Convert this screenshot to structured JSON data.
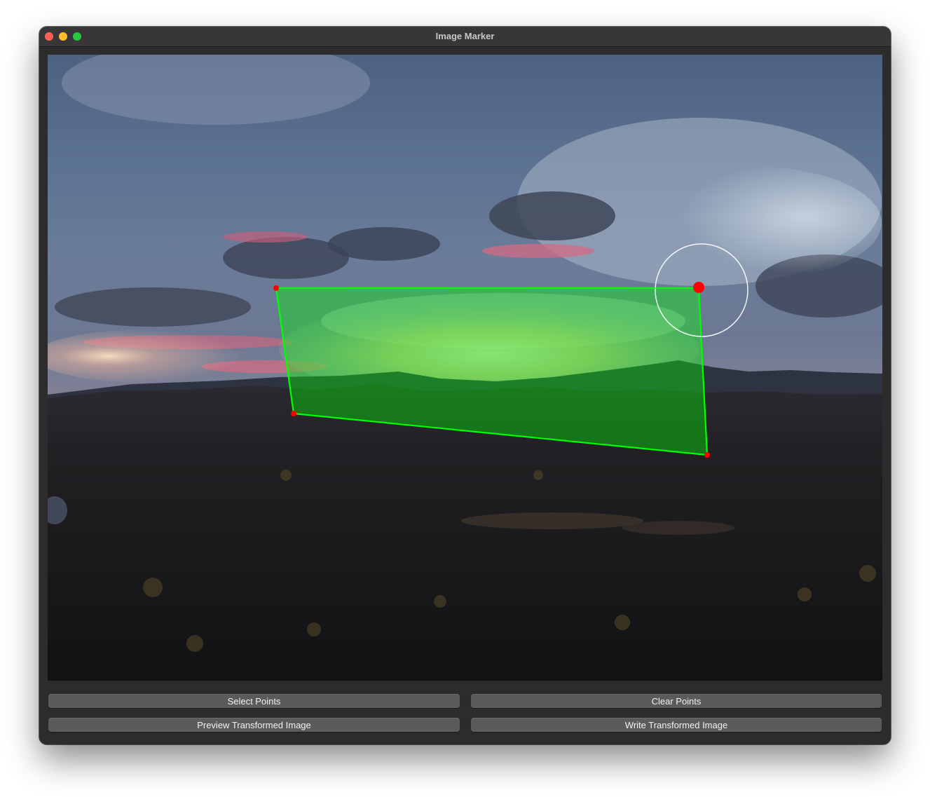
{
  "window": {
    "title": "Image Marker"
  },
  "canvas": {
    "image": "landscape-photo",
    "selected_points_count": 4,
    "overlay_color": "#00ff00",
    "point_color": "#ff0000"
  },
  "controls": {
    "select_points_label": "Select Points",
    "clear_points_label": "Clear Points",
    "preview_label": "Preview Transformed Image",
    "write_label": "Write Transformed Image"
  },
  "colors": {
    "close": "#ff5f57",
    "minimize": "#febc2e",
    "zoom": "#28c840",
    "button": "#5c5b5c",
    "window": "#2d2b2c"
  }
}
